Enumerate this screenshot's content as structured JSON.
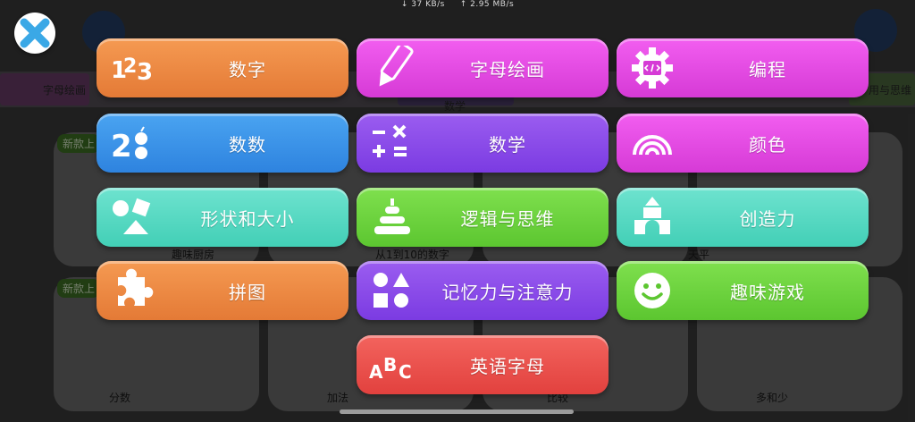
{
  "status_bar": {
    "download": "37 KB/s",
    "upload": "2.95 MB/s"
  },
  "background": {
    "tabs": [
      "字母绘画",
      "数学",
      "用与思维"
    ],
    "badges": [
      "新款上",
      "新款上"
    ],
    "card_labels": [
      "趣味厨房",
      "从1到10的数字",
      "天平",
      "分数",
      "加法",
      "比较",
      "多和少"
    ]
  },
  "menu": {
    "items": [
      {
        "label": "数字",
        "icon": "numbers-123-icon",
        "color": "orange"
      },
      {
        "label": "数数",
        "icon": "counting-apples-icon",
        "color": "blue"
      },
      {
        "label": "形状和大小",
        "icon": "shapes-icon",
        "color": "teal"
      },
      {
        "label": "拼图",
        "icon": "puzzle-piece-icon",
        "color": "orange"
      },
      {
        "label": "字母绘画",
        "icon": "pencil-icon",
        "color": "magenta"
      },
      {
        "label": "数学",
        "icon": "math-operators-icon",
        "color": "purple"
      },
      {
        "label": "逻辑与思维",
        "icon": "stacking-rings-icon",
        "color": "green"
      },
      {
        "label": "记忆力与注意力",
        "icon": "memory-shapes-icon",
        "color": "purple"
      },
      {
        "label": "英语字母",
        "icon": "abc-letters-icon",
        "color": "red"
      },
      {
        "label": "编程",
        "icon": "code-gear-icon",
        "color": "magenta"
      },
      {
        "label": "颜色",
        "icon": "rainbow-icon",
        "color": "magenta"
      },
      {
        "label": "创造力",
        "icon": "building-blocks-icon",
        "color": "teal"
      },
      {
        "label": "趣味游戏",
        "icon": "smiley-icon",
        "color": "green"
      }
    ]
  }
}
